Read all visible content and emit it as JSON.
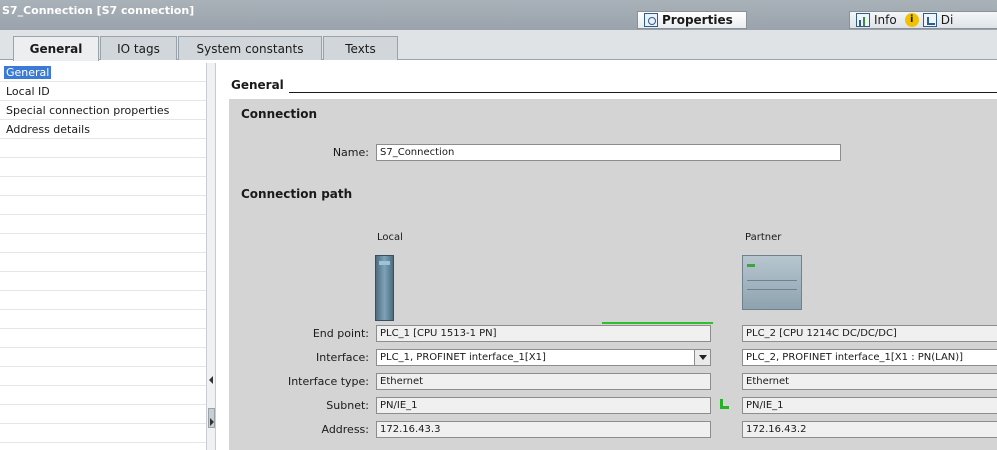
{
  "window": {
    "title": "S7_Connection [S7 connection]",
    "top_tabs": [
      {
        "label": "Properties",
        "icon": "magnifier-icon"
      },
      {
        "label": "Info",
        "icon": "info-chart-icon"
      },
      {
        "label": "Di",
        "icon": "diagnostics-icon"
      }
    ]
  },
  "subtabs": [
    "General",
    "IO tags",
    "System constants",
    "Texts"
  ],
  "nav": {
    "items": [
      "General",
      "Local ID",
      "Special connection properties",
      "Address details"
    ]
  },
  "main": {
    "header": "General",
    "connection": {
      "title": "Connection",
      "name_label": "Name:",
      "name_value": "S7_Connection"
    },
    "path": {
      "title": "Connection path",
      "local_label": "Local",
      "partner_label": "Partner",
      "rows": [
        {
          "label": "End point:",
          "local": "PLC_1 [CPU 1513-1 PN]",
          "partner": "PLC_2 [CPU 1214C DC/DC/DC]"
        },
        {
          "label": "Interface:",
          "local": "PLC_1, PROFINET interface_1[X1]",
          "partner": "PLC_2, PROFINET interface_1[X1 : PN(LAN)]"
        },
        {
          "label": "Interface type:",
          "local": "Ethernet",
          "partner": "Ethernet"
        },
        {
          "label": "Subnet:",
          "local": "PN/IE_1",
          "partner": "PN/IE_1"
        },
        {
          "label": "Address:",
          "local": "172.16.43.3",
          "partner": "172.16.43.2"
        }
      ]
    }
  },
  "colors": {
    "selection": "#3b7bd4",
    "connection_line": "#2fbf2f",
    "title_bar": "#a9b1b9"
  }
}
